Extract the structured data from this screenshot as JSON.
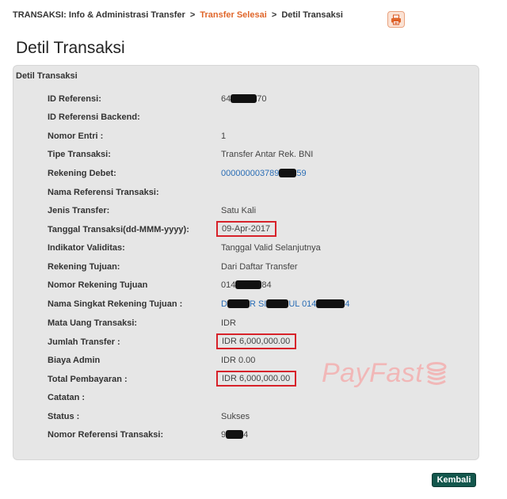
{
  "breadcrumb": {
    "root": "TRANSAKSI: Info & Administrasi Transfer",
    "sep1": ">",
    "link": "Transfer Selesai",
    "sep2": ">",
    "current": "Detil Transaksi"
  },
  "page_title": "Detil Transaksi",
  "panel_title": "Detil Transaksi",
  "fields": [
    {
      "label": "ID Referensi:",
      "v1": "64",
      "v2": "70"
    },
    {
      "label": "ID Referensi Backend:",
      "value": ""
    },
    {
      "label": "Nomor Entri :",
      "value": "1"
    },
    {
      "label": "Tipe Transaksi:",
      "value": "Transfer Antar Rek. BNI"
    },
    {
      "label": "Rekening Debet:",
      "v1": "000000003789",
      "v2": "59"
    },
    {
      "label": "Nama Referensi Transaksi:",
      "value": ""
    },
    {
      "label": "Jenis Transfer:",
      "value": "Satu Kali"
    },
    {
      "label": "Tanggal Transaksi(dd-MMM-yyyy):",
      "value": "09-Apr-2017"
    },
    {
      "label": "Indikator Validitas:",
      "value": "Tanggal Valid Selanjutnya"
    },
    {
      "label": "Rekening Tujuan:",
      "value": "Dari Daftar Transfer"
    },
    {
      "label": "Nomor Rekening Tujuan",
      "v1": "014",
      "v2": "84"
    },
    {
      "label": "Nama Singkat Rekening Tujuan :",
      "v1": "D",
      "v2": "R SI",
      "v3": "UL 014",
      "v4": "4"
    },
    {
      "label": "Mata Uang Transaksi:",
      "value": "IDR"
    },
    {
      "label": "Jumlah Transfer :",
      "value": "IDR 6,000,000.00"
    },
    {
      "label": "Biaya Admin",
      "value": "IDR 0.00"
    },
    {
      "label": "Total Pembayaran :",
      "value": "IDR 6,000,000.00"
    },
    {
      "label": "Catatan :",
      "value": ""
    },
    {
      "label": "Status :",
      "value": "Sukses"
    },
    {
      "label": "Nomor Referensi Transaksi:",
      "v1": "9",
      "v2": "4"
    }
  ],
  "watermark": "PayFast",
  "back_button": "Kembali",
  "colors": {
    "link": "#2a6db5",
    "breadcrumb_link": "#e0662a",
    "highlight_box": "#d7222a",
    "button": "#14574d",
    "panel": "#e6e6e6"
  },
  "icons": {
    "print": "printer-icon",
    "watermark_logo": "coin-stack-icon"
  }
}
